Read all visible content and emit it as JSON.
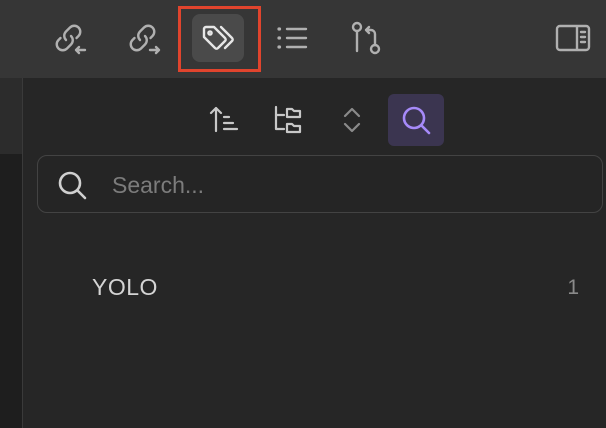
{
  "tabs": [
    {
      "name": "backlinks",
      "icon": "link-incoming-icon",
      "active": false
    },
    {
      "name": "outgoing-links",
      "icon": "link-outgoing-icon",
      "active": false
    },
    {
      "name": "tags",
      "icon": "tags-icon",
      "active": true
    },
    {
      "name": "outline",
      "icon": "list-icon",
      "active": false
    },
    {
      "name": "file-properties",
      "icon": "git-compare-icon",
      "active": false
    }
  ],
  "sidebar_toggle": {
    "icon": "sidebar-right-icon"
  },
  "nav": [
    {
      "name": "sort",
      "icon": "sort-icon"
    },
    {
      "name": "nested-tags",
      "icon": "nested-tags-icon"
    },
    {
      "name": "collapse-expand",
      "icon": "chevrons-up-down-icon"
    },
    {
      "name": "search-toggle",
      "icon": "search-icon",
      "active": true
    }
  ],
  "search": {
    "placeholder": "Search...",
    "value": ""
  },
  "tags": [
    {
      "name": "YOLO",
      "count": "1"
    }
  ],
  "colors": {
    "highlight_box": "#e0442d",
    "active_nav_bg": "#3b3550",
    "accent": "#a68af9"
  }
}
